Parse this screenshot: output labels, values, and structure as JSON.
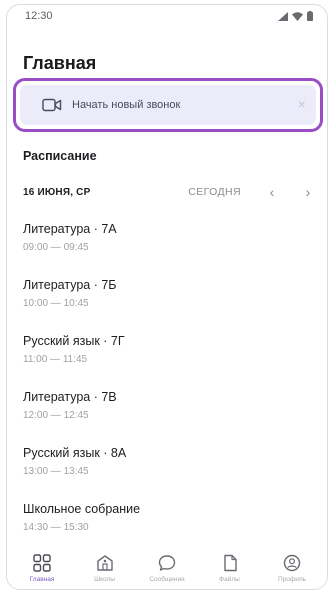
{
  "statusbar": {
    "time": "12:30"
  },
  "header": {
    "title": "Главная"
  },
  "call_card": {
    "label": "Начать новый звонок"
  },
  "schedule": {
    "title": "Расписание",
    "date": "16 ИЮНЯ, СР",
    "today_label": "СЕГОДНЯ",
    "prev": "‹",
    "next": "›",
    "lessons": [
      {
        "title": "Литература · 7А",
        "time": "09:00 — 09:45"
      },
      {
        "title": "Литература · 7Б",
        "time": "10:00 — 10:45"
      },
      {
        "title": "Русский язык · 7Г",
        "time": "11:00 — 11:45"
      },
      {
        "title": "Литература · 7В",
        "time": "12:00 — 12:45"
      },
      {
        "title": "Русский язык · 8А",
        "time": "13:00 — 13:45"
      },
      {
        "title": "Школьное собрание",
        "time": "14:30 — 15:30"
      }
    ]
  },
  "bottom_nav": {
    "items": [
      {
        "label": "Главная",
        "icon": "home-grid-icon"
      },
      {
        "label": "Школы",
        "icon": "school-icon"
      },
      {
        "label": "Сообщения",
        "icon": "chat-icon"
      },
      {
        "label": "Файлы",
        "icon": "file-icon"
      },
      {
        "label": "Профиль",
        "icon": "profile-icon"
      }
    ],
    "active_color": "#7a5bc4"
  },
  "colors": {
    "highlight_border": "#9b4dc8",
    "call_bg": "#ecebfa"
  }
}
